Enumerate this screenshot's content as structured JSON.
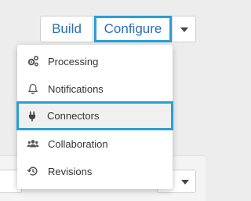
{
  "toolbar": {
    "build_label": "Build",
    "configure_label": "Configure"
  },
  "menu": {
    "items": [
      {
        "label": "Processing",
        "icon": "gears-icon"
      },
      {
        "label": "Notifications",
        "icon": "bell-icon"
      },
      {
        "label": "Connectors",
        "icon": "plug-icon",
        "active": true
      },
      {
        "label": "Collaboration",
        "icon": "users-icon"
      },
      {
        "label": "Revisions",
        "icon": "history-icon"
      }
    ]
  },
  "colors": {
    "accent": "#2a9fd6",
    "link": "#2a6fb8",
    "background": "#ededed"
  }
}
